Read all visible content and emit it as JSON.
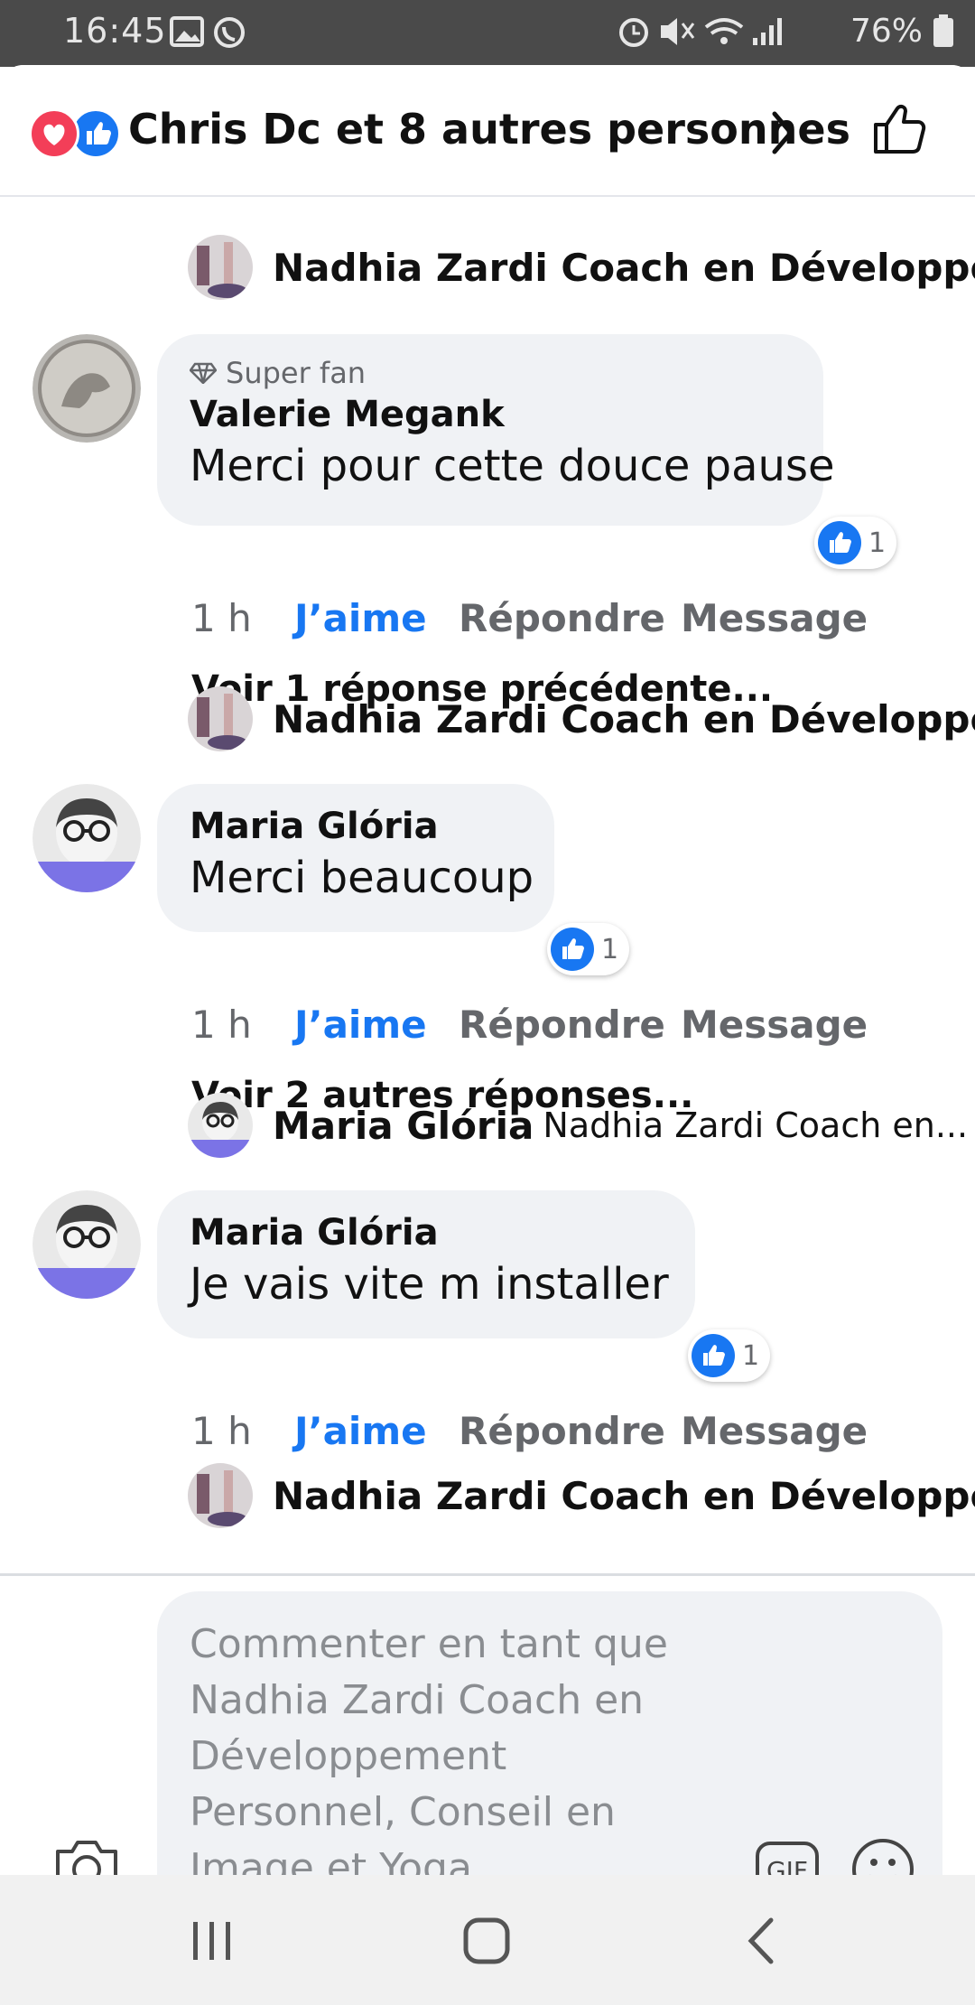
{
  "status_bar": {
    "time": "16:45",
    "battery": "76%",
    "left_icons": [
      "gallery-icon",
      "whatsapp-icon"
    ],
    "right_icons": [
      "alarm-icon",
      "mute-icon",
      "wifi-icon",
      "signal-icon",
      "battery-icon"
    ]
  },
  "header": {
    "reactors": "Chris Dc et 8 autres personnes",
    "reaction_icons": [
      "heart-reaction",
      "like-reaction"
    ]
  },
  "reply_previews": [
    {
      "name": "Nadhia Zardi Coach en Développem...",
      "snippet": "",
      "more": "..."
    },
    {
      "name": "Nadhia Zardi Coach en Développem...",
      "snippet": "",
      "more": "..."
    },
    {
      "name": "Maria Glória",
      "snippet": "Nadhia Zardi Coach en...",
      "more": ""
    },
    {
      "name": "Nadhia Zardi Coach en Développem...",
      "snippet": "",
      "more": "..."
    }
  ],
  "comments": [
    {
      "badge": "Super fan",
      "author": "Valerie Megank",
      "text": "Merci pour cette douce pause",
      "reaction_count": "1",
      "time": "1 h",
      "like_label": "J’aime",
      "reply_label": "Répondre",
      "message_label": "Message",
      "more_replies": "Voir 1 réponse précédente..."
    },
    {
      "badge": "",
      "author": "Maria Glória",
      "text": "Merci beaucoup",
      "reaction_count": "1",
      "time": "1 h",
      "like_label": "J’aime",
      "reply_label": "Répondre",
      "message_label": "Message",
      "more_replies": "Voir 2 autres réponses..."
    },
    {
      "badge": "",
      "author": "Maria Glória",
      "text": "Je vais vite m installer",
      "reaction_count": "1",
      "time": "1 h",
      "like_label": "J’aime",
      "reply_label": "Répondre",
      "message_label": "Message",
      "more_replies": ""
    }
  ],
  "composer": {
    "placeholder": "Commenter en tant que Nadhia Zardi Coach en Développement Personnel, Conseil en Image et Yoga",
    "gif_label": "GIF"
  },
  "colors": {
    "accent": "#1877f2",
    "heart": "#f33e58",
    "bubble": "#f0f2f5",
    "muted_text": "#65676b"
  }
}
